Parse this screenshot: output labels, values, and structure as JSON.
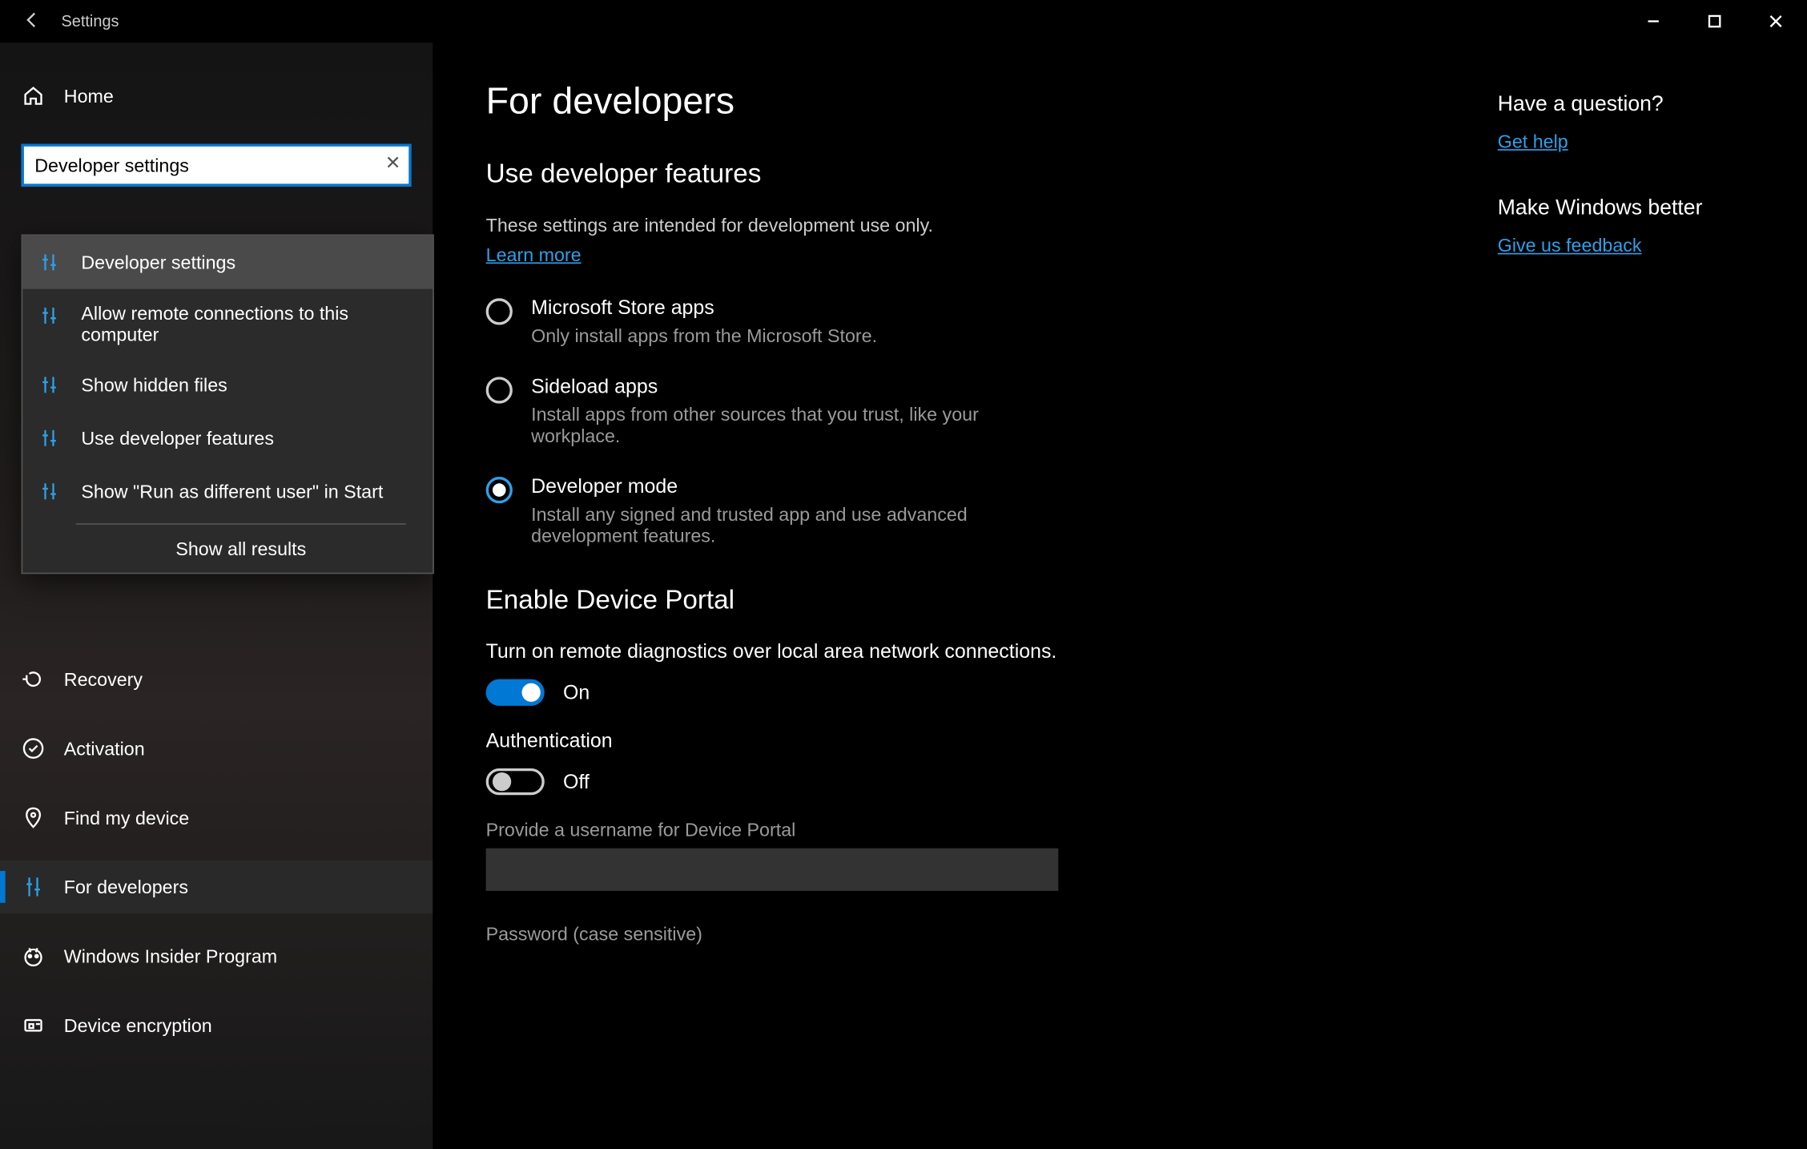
{
  "titlebar": {
    "app_name": "Settings"
  },
  "sidebar": {
    "home_label": "Home",
    "search_value": "Developer settings",
    "items": [
      {
        "label": "Recovery"
      },
      {
        "label": "Activation"
      },
      {
        "label": "Find my device"
      },
      {
        "label": "For developers"
      },
      {
        "label": "Windows Insider Program"
      },
      {
        "label": "Device encryption"
      }
    ]
  },
  "dropdown": {
    "items": [
      "Developer settings",
      "Allow remote connections to this computer",
      "Show hidden files",
      "Use developer features",
      "Show \"Run as different user\" in Start"
    ],
    "footer": "Show all results"
  },
  "main": {
    "title": "For developers",
    "section1_title": "Use developer features",
    "section1_desc": "These settings are intended for development use only.",
    "learn_more": "Learn more",
    "radios": [
      {
        "title": "Microsoft Store apps",
        "desc": "Only install apps from the Microsoft Store."
      },
      {
        "title": "Sideload apps",
        "desc": "Install apps from other sources that you trust, like your workplace."
      },
      {
        "title": "Developer mode",
        "desc": "Install any signed and trusted app and use advanced development features."
      }
    ],
    "section2_title": "Enable Device Portal",
    "portal_desc": "Turn on remote diagnostics over local area network connections.",
    "toggle_on_label": "On",
    "auth_label": "Authentication",
    "toggle_off_label": "Off",
    "username_label": "Provide a username for Device Portal",
    "password_label": "Password (case sensitive)"
  },
  "aside": {
    "q_heading": "Have a question?",
    "help_link": "Get help",
    "fb_heading": "Make Windows better",
    "fb_link": "Give us feedback"
  }
}
